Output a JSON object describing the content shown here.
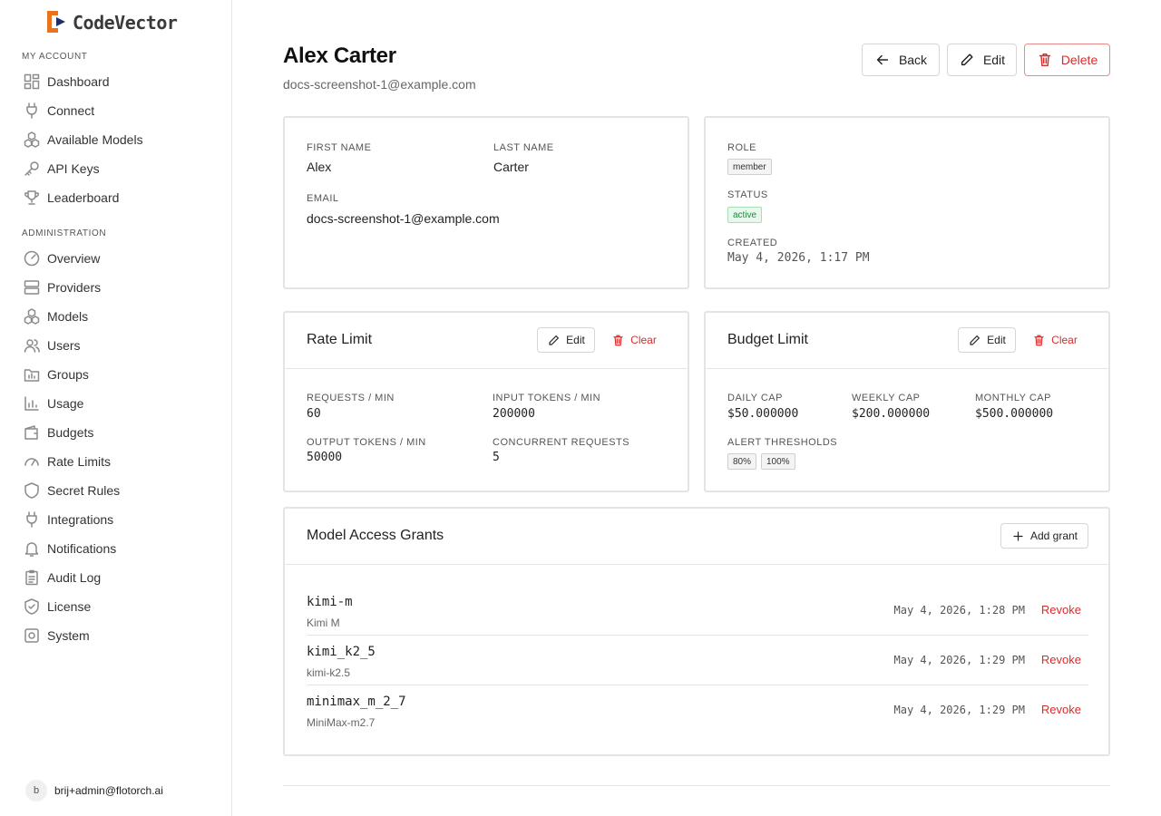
{
  "app": {
    "name": "CodeVector",
    "brand_colors": {
      "orange": "#e8731c",
      "navy": "#1d2e6b"
    }
  },
  "sidebar": {
    "my_account_label": "MY ACCOUNT",
    "my_account_items": [
      {
        "label": "Dashboard",
        "icon": "dashboard-icon"
      },
      {
        "label": "Connect",
        "icon": "plug-icon"
      },
      {
        "label": "Available Models",
        "icon": "cubes-icon"
      },
      {
        "label": "API Keys",
        "icon": "key-icon"
      },
      {
        "label": "Leaderboard",
        "icon": "trophy-icon"
      }
    ],
    "admin_label": "ADMINISTRATION",
    "admin_items": [
      {
        "label": "Overview",
        "icon": "gauge-icon"
      },
      {
        "label": "Providers",
        "icon": "server-icon"
      },
      {
        "label": "Models",
        "icon": "cubes-icon"
      },
      {
        "label": "Users",
        "icon": "users-icon"
      },
      {
        "label": "Groups",
        "icon": "folder-icon"
      },
      {
        "label": "Usage",
        "icon": "bar-chart-icon"
      },
      {
        "label": "Budgets",
        "icon": "wallet-icon"
      },
      {
        "label": "Rate Limits",
        "icon": "speedometer-icon"
      },
      {
        "label": "Secret Rules",
        "icon": "shield-icon"
      },
      {
        "label": "Integrations",
        "icon": "plug-icon"
      },
      {
        "label": "Notifications",
        "icon": "bell-icon"
      },
      {
        "label": "Audit Log",
        "icon": "clipboard-icon"
      },
      {
        "label": "License",
        "icon": "shield-check-icon"
      },
      {
        "label": "System",
        "icon": "cog-icon"
      }
    ],
    "user": {
      "avatar_letter": "b",
      "email": "brij+admin@flotorch.ai"
    }
  },
  "header": {
    "title": "Alex Carter",
    "subtitle": "docs-screenshot-1@example.com",
    "back_label": "Back",
    "edit_label": "Edit",
    "delete_label": "Delete"
  },
  "profile": {
    "first_name_label": "FIRST NAME",
    "first_name": "Alex",
    "last_name_label": "LAST NAME",
    "last_name": "Carter",
    "email_label": "EMAIL",
    "email": "docs-screenshot-1@example.com"
  },
  "account": {
    "role_label": "ROLE",
    "role": "member",
    "status_label": "STATUS",
    "status": "active",
    "created_label": "CREATED",
    "created": "May 4, 2026, 1:17 PM"
  },
  "rate_limit": {
    "title": "Rate Limit",
    "edit_label": "Edit",
    "clear_label": "Clear",
    "requests_label": "REQUESTS / MIN",
    "requests": "60",
    "input_label": "INPUT TOKENS / MIN",
    "input": "200000",
    "output_label": "OUTPUT TOKENS / MIN",
    "output": "50000",
    "concurrent_label": "CONCURRENT REQUESTS",
    "concurrent": "5"
  },
  "budget_limit": {
    "title": "Budget Limit",
    "edit_label": "Edit",
    "clear_label": "Clear",
    "daily_label": "DAILY CAP",
    "daily": "$50.000000",
    "weekly_label": "WEEKLY CAP",
    "weekly": "$200.000000",
    "monthly_label": "MONTHLY CAP",
    "monthly": "$500.000000",
    "alerts_label": "ALERT THRESHOLDS",
    "alerts": [
      "80%",
      "100%"
    ]
  },
  "grants": {
    "title": "Model Access Grants",
    "add_label": "Add grant",
    "revoke_label": "Revoke",
    "rows": [
      {
        "name": "kimi-m",
        "desc": "Kimi M",
        "date": "May 4, 2026, 1:28 PM"
      },
      {
        "name": "kimi_k2_5",
        "desc": "kimi-k2.5",
        "date": "May 4, 2026, 1:29 PM"
      },
      {
        "name": "minimax_m_2_7",
        "desc": "MiniMax-m2.7",
        "date": "May 4, 2026, 1:29 PM"
      }
    ]
  }
}
